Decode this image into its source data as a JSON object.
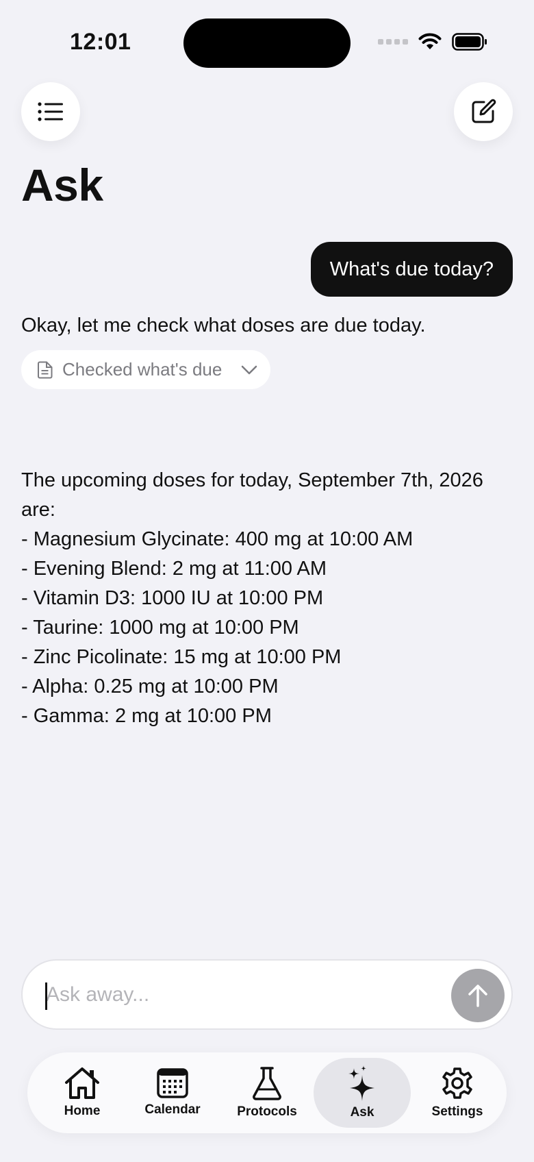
{
  "status": {
    "time": "12:01"
  },
  "header": {
    "title": "Ask"
  },
  "chat": {
    "user_message": "What's due today?",
    "assistant_intro": "Okay, let me check what doses are due today.",
    "tool_chip": "Checked what's due",
    "answer_lines": [
      "The upcoming doses for today, September 7th, 2026",
      "are:",
      "- Magnesium Glycinate: 400 mg at 10:00 AM",
      "- Evening Blend: 2 mg at 11:00 AM",
      "- Vitamin D3: 1000 IU at 10:00 PM",
      "- Taurine: 1000 mg at 10:00 PM",
      "- Zinc Picolinate: 15 mg at 10:00 PM",
      "- Alpha: 0.25 mg at 10:00 PM",
      "- Gamma: 2 mg at 10:00 PM"
    ]
  },
  "input": {
    "placeholder": "Ask away..."
  },
  "tabs": [
    {
      "label": "Home",
      "icon": "house-icon"
    },
    {
      "label": "Calendar",
      "icon": "calendar-icon"
    },
    {
      "label": "Protocols",
      "icon": "flask-icon"
    },
    {
      "label": "Ask",
      "icon": "sparkles-icon",
      "active": true
    },
    {
      "label": "Settings",
      "icon": "gear-icon"
    }
  ],
  "colors": {
    "background": "#f2f2f7",
    "user_bubble": "#111111",
    "send_disabled": "#a6a6aa",
    "active_tab": "#e5e5ea"
  }
}
